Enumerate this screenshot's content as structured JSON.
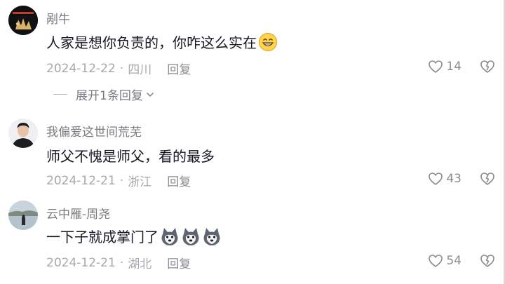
{
  "comments": [
    {
      "username": "剐牛",
      "text": "人家是想你负责的，你咋这么实在",
      "date": "2024-12-22",
      "location": "四川",
      "reply_label": "回复",
      "likes": "14",
      "avatar_icon": "dark-logo-avatar",
      "emojis": [
        "grin-emoji"
      ]
    },
    {
      "username": "我偏爱这世间荒芜",
      "text": "师父不愧是师父，看的最多",
      "date": "2024-12-21",
      "location": "浙江",
      "reply_label": "回复",
      "likes": "43",
      "avatar_icon": "person-avatar",
      "emojis": []
    },
    {
      "username": "云中雁-周尧",
      "text": "一下子就成掌门了",
      "date": "2024-12-21",
      "location": "湖北",
      "reply_label": "回复",
      "likes": "54",
      "avatar_icon": "landscape-avatar",
      "emojis": [
        "husky-emoji",
        "husky-emoji",
        "husky-emoji"
      ]
    }
  ],
  "expand_replies": {
    "label": "展开1条回复"
  },
  "colors": {
    "text_primary": "#161823",
    "text_secondary": "#7a7b80",
    "text_meta": "#a7a8ad"
  }
}
